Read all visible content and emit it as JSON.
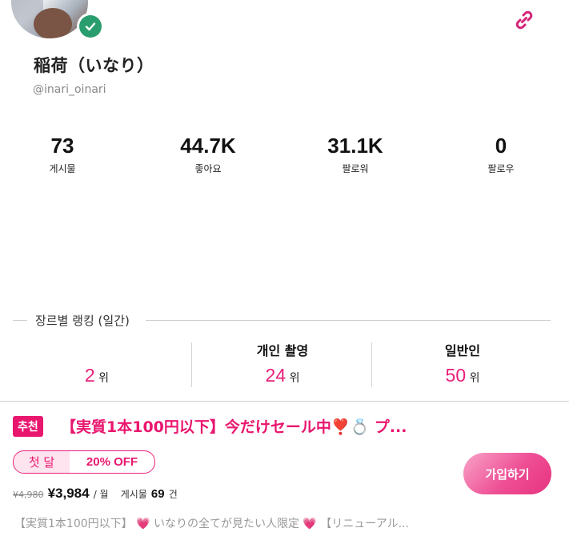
{
  "profile": {
    "display_name": "稲荷（いなり）",
    "handle": "@inari_oinari"
  },
  "stats": [
    {
      "value": "73",
      "label": "게시물"
    },
    {
      "value": "44.7K",
      "label": "좋아요"
    },
    {
      "value": "31.1K",
      "label": "팔로워"
    },
    {
      "value": "0",
      "label": "팔로우"
    }
  ],
  "ranking": {
    "title": "장르별 랭킹 (일간)",
    "items": [
      {
        "category": "",
        "rank": "2",
        "unit": "위"
      },
      {
        "category": "개인 촬영",
        "rank": "24",
        "unit": "위"
      },
      {
        "category": "일반인",
        "rank": "50",
        "unit": "위"
      }
    ]
  },
  "plan": {
    "badge": "추천",
    "title": "【実質1本100円以下】今だけセール中❣️💍 プ...",
    "promo_first": "첫 달",
    "promo_off": "20% OFF",
    "old_price": "¥4,980",
    "price": "¥3,984",
    "per": "/ 월",
    "posts_label": "게시물",
    "posts_count": "69",
    "posts_unit": "건",
    "join_label": "가입하기",
    "description": "【実質1本100円以下】 💗 いなりの全てが見たい人限定 💗 【リニューアル..."
  },
  "colors": {
    "accent": "#e9166e",
    "verified": "#2a9d6f"
  },
  "icons": {
    "verified": "check-circle-icon",
    "link": "link-icon"
  }
}
